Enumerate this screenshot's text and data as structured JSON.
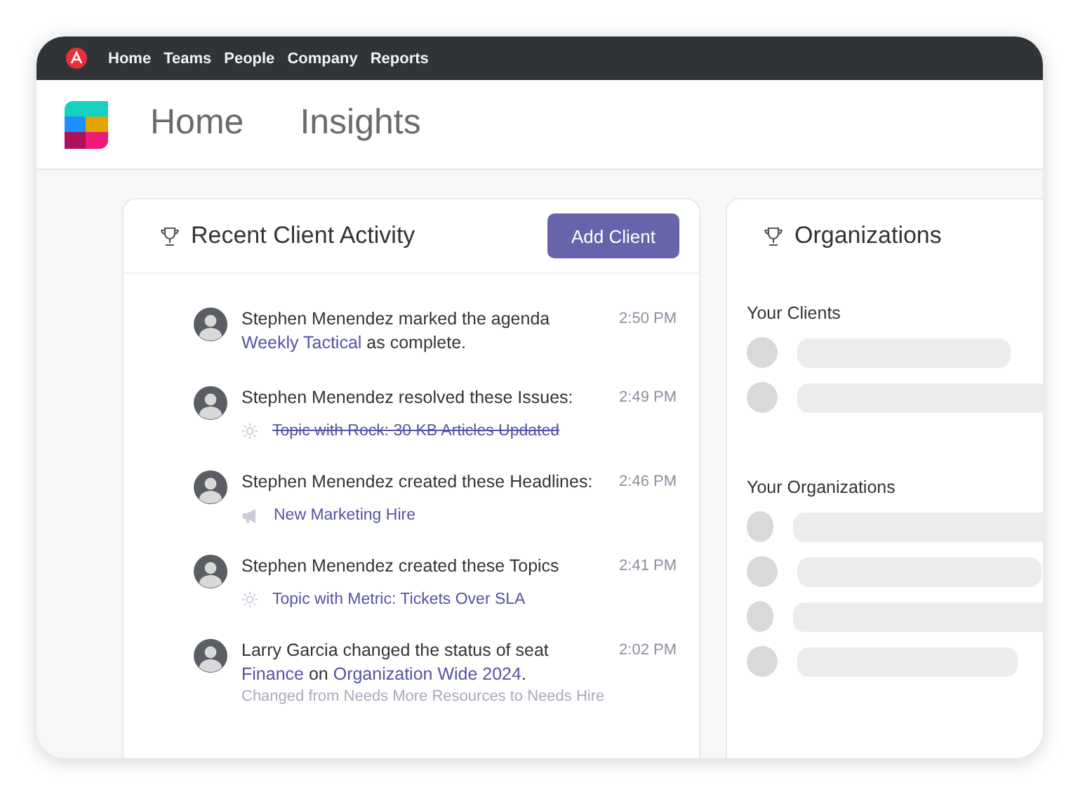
{
  "top_nav": {
    "items": [
      "Home",
      "Teams",
      "People",
      "Company",
      "Reports"
    ]
  },
  "header": {
    "tabs": [
      {
        "label": "Home",
        "selected": false
      },
      {
        "label": "Insights",
        "selected": false
      }
    ]
  },
  "activity_card": {
    "title": "Recent Client Activity",
    "button": "Add Client",
    "items": [
      {
        "message": [
          {
            "kind": "plain",
            "text": "Stephen Menendez marked the agenda "
          },
          {
            "kind": "link",
            "text": "Weekly Tactical"
          },
          {
            "kind": "plain",
            "text": " as complete."
          }
        ],
        "time": "2:50 PM"
      },
      {
        "message": [
          {
            "kind": "plain",
            "text": "Stephen Menendez resolved these Issues:"
          }
        ],
        "time": "2:49 PM",
        "attachment": {
          "kind": "sun",
          "label": "Topic with Rock: 30 KB Articles Updated",
          "struck": true
        }
      },
      {
        "message": [
          {
            "kind": "plain",
            "text": "Stephen Menendez created these Headlines:"
          }
        ],
        "time": "2:46 PM",
        "attachment": {
          "kind": "megaphone",
          "label": "New Marketing Hire",
          "struck": false
        }
      },
      {
        "message": [
          {
            "kind": "plain",
            "text": "Stephen Menendez created these Topics"
          }
        ],
        "time": "2:41 PM",
        "attachment": {
          "kind": "sun",
          "label": "Topic with Metric: Tickets Over SLA",
          "struck": false
        }
      },
      {
        "message": [
          {
            "kind": "plain",
            "text": "Larry Garcia changed the status of seat "
          },
          {
            "kind": "link",
            "text": "Finance"
          },
          {
            "kind": "plain",
            "text": " on "
          },
          {
            "kind": "link",
            "text": "Organization Wide 2024"
          },
          {
            "kind": "plain",
            "text": "."
          }
        ],
        "time": "2:02 PM",
        "note": "Changed from Needs More Resources to Needs Hire"
      }
    ]
  },
  "organizations_card": {
    "title": "Organizations",
    "sections": [
      {
        "title": "Your Clients"
      },
      {
        "title": "Your Organizations"
      }
    ]
  }
}
